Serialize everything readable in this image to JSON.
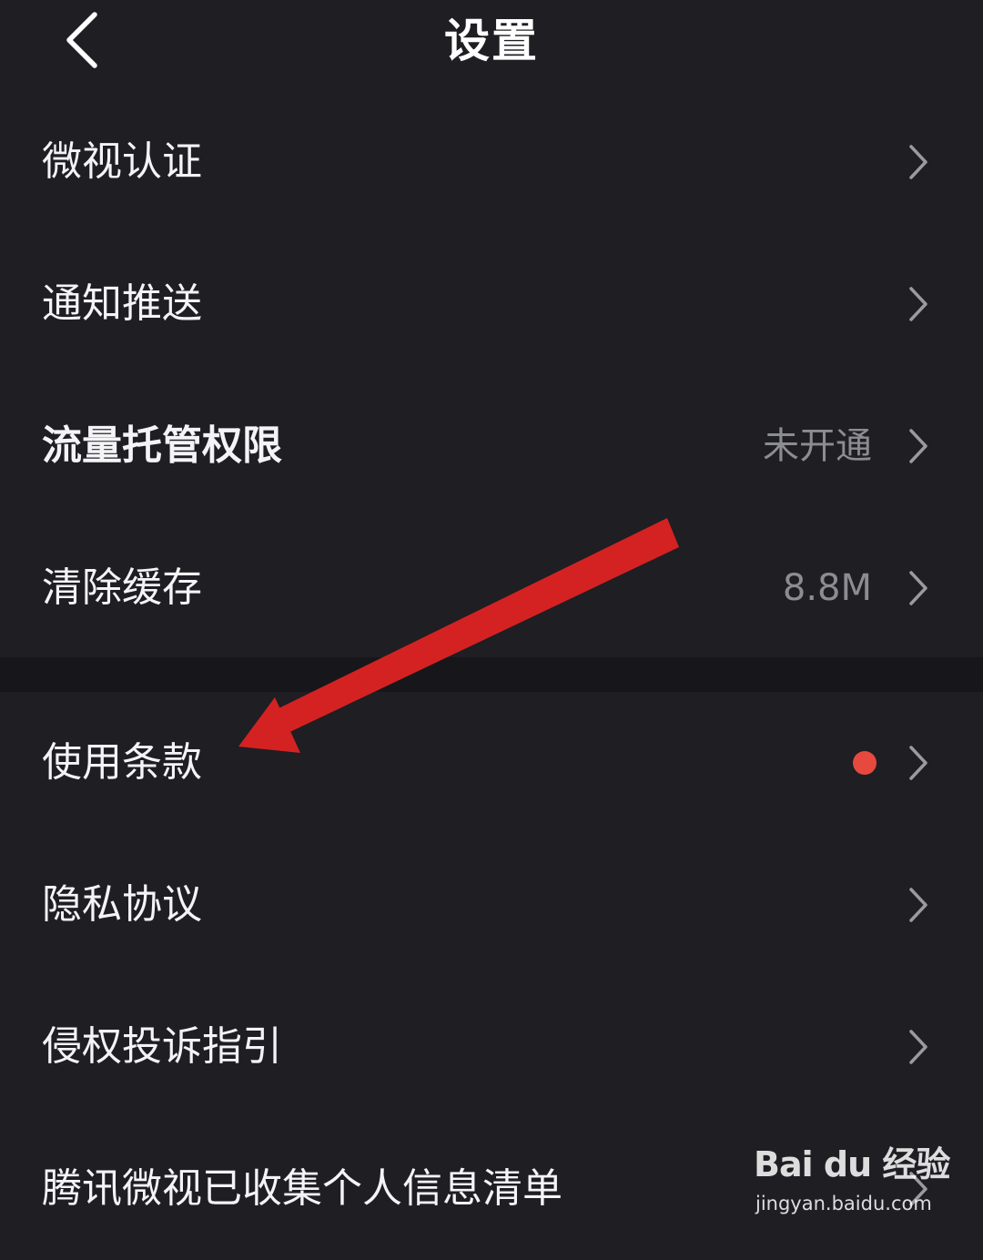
{
  "header": {
    "title": "设置"
  },
  "rows": [
    {
      "label": "微视认证",
      "value": ""
    },
    {
      "label": "通知推送",
      "value": ""
    },
    {
      "label": "流量托管权限",
      "value": "未开通"
    },
    {
      "label": "清除缓存",
      "value": "8.8M"
    },
    {
      "label": "使用条款",
      "value": ""
    },
    {
      "label": "隐私协议",
      "value": ""
    },
    {
      "label": "侵权投诉指引",
      "value": ""
    },
    {
      "label": "腾讯微视已收集个人信息清单",
      "value": ""
    }
  ],
  "colors": {
    "background": "#1e1e23",
    "divider": "#17171b",
    "text": "#f4f4f6",
    "secondary_text": "#8c8c93",
    "badge": "#e8493f",
    "annotation_arrow": "#d42222"
  },
  "icons": {
    "back": "chevron-left-icon",
    "row_arrow": "chevron-right-icon",
    "badge": "red-dot"
  },
  "watermark": {
    "logo": "Bai du 经验",
    "url": "jingyan.baidu.com"
  }
}
